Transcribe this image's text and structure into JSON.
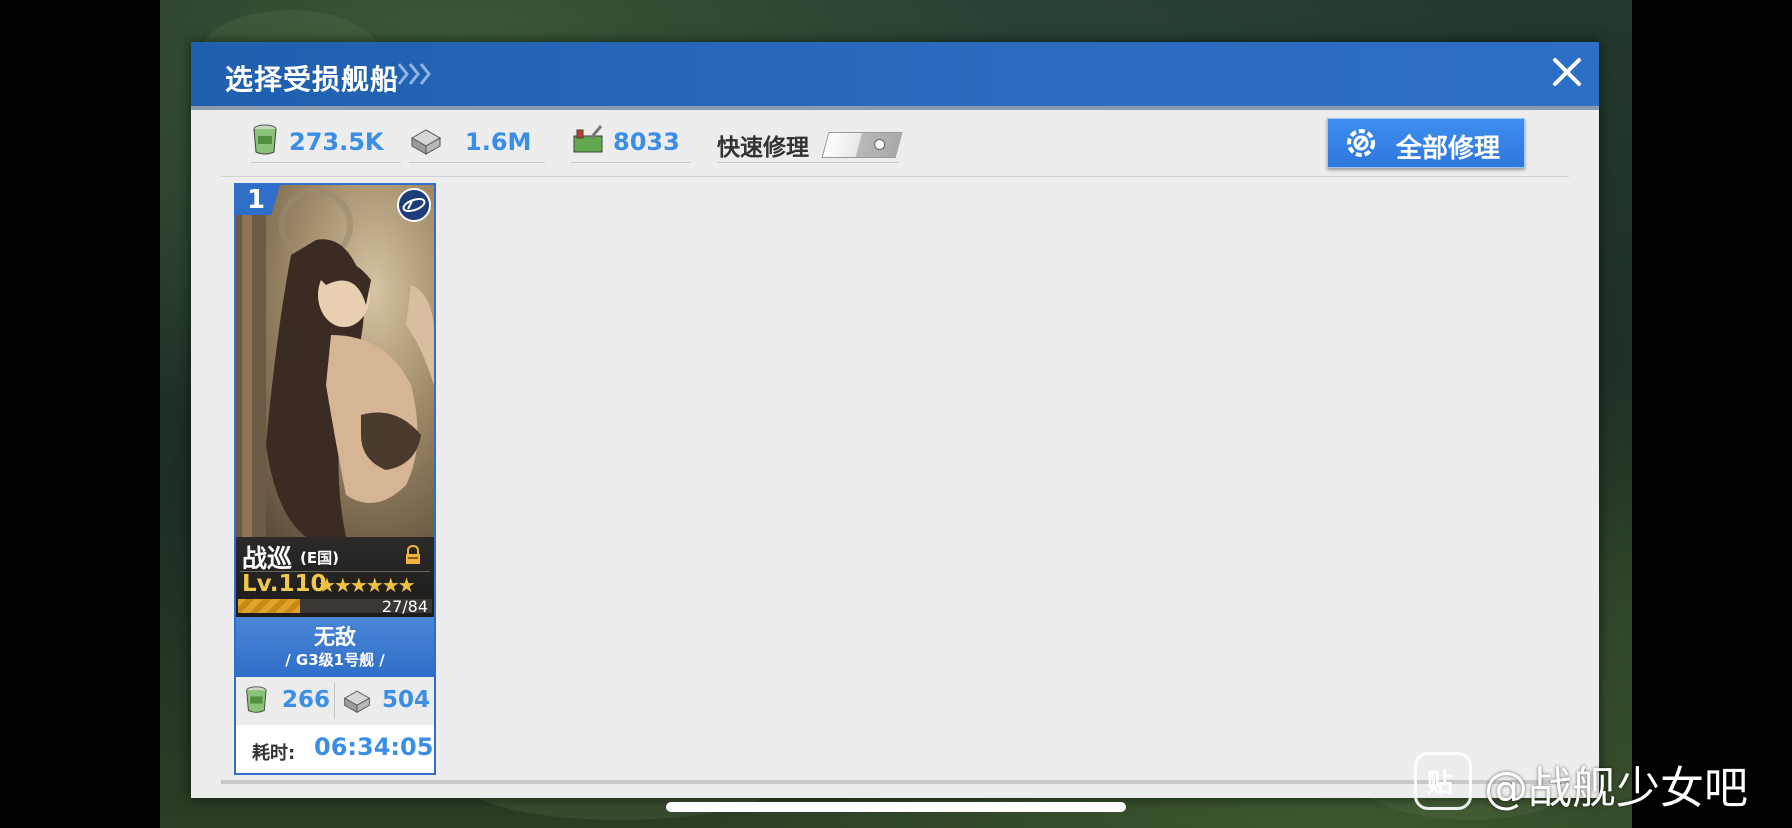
{
  "dialog": {
    "title": "选择受损舰船",
    "close_icon": "close-icon"
  },
  "resources": {
    "fuel": {
      "icon": "fuel-icon",
      "value": "273.5K"
    },
    "steel": {
      "icon": "steel-icon",
      "value": "1.6M"
    },
    "repair_kit": {
      "icon": "repair-kit-icon",
      "value": "8033"
    }
  },
  "quick_repair": {
    "label": "快速修理",
    "enabled": false
  },
  "repair_all": {
    "label": "全部修理",
    "icon": "gear-wrench-icon"
  },
  "ships": [
    {
      "index": "1",
      "type": "战巡",
      "country": "(E国)",
      "level": "Lv.110",
      "stars": "★★★★★★",
      "exp": "27/84",
      "exp_fraction": 0.32,
      "name": "无敌",
      "class": "/ G3级1号舰 /",
      "cost_fuel": "266",
      "cost_steel": "504",
      "time_label": "耗时:",
      "time": "06:34:05"
    }
  ],
  "watermark": {
    "logo_char": "贴",
    "text": "@战舰少女吧"
  },
  "colors": {
    "header": "#2c6cc0",
    "accent_blue": "#3a8ee8",
    "panel_bg": "#ededed",
    "star_gold": "#f0c040"
  }
}
